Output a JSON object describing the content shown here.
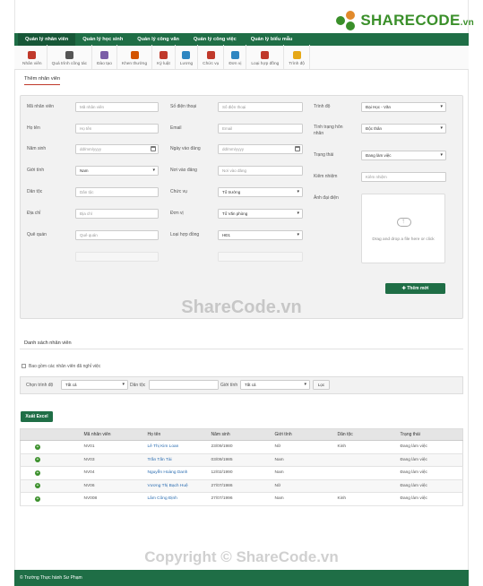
{
  "brand": {
    "logo_text": "SHARECODE",
    "logo_suffix": ".vn"
  },
  "topnav": {
    "items": [
      {
        "label": "Quản lý nhân viên",
        "active": true
      },
      {
        "label": "Quản lý học sinh"
      },
      {
        "label": "Quản lý công văn"
      },
      {
        "label": "Quản lý công việc"
      },
      {
        "label": "Quản lý biểu mẫu"
      }
    ]
  },
  "toolbar": {
    "items": [
      {
        "label": "Nhân viên",
        "icon": "user-icon",
        "color": "#c0392b"
      },
      {
        "label": "Quá trình công tác",
        "icon": "progress-icon",
        "color": "#555555"
      },
      {
        "label": "Đào tạo",
        "icon": "book-icon",
        "color": "#7b5ea7"
      },
      {
        "label": "Khen thưởng",
        "icon": "gift-icon",
        "color": "#d35400"
      },
      {
        "label": "Kỷ luật",
        "icon": "shield-icon",
        "color": "#c0392b"
      },
      {
        "label": "Lương",
        "icon": "money-icon",
        "color": "#2e86c1"
      },
      {
        "label": "Chức vụ",
        "icon": "chair-icon",
        "color": "#c0392b"
      },
      {
        "label": "Đơn vị",
        "icon": "unit-icon",
        "color": "#2e86c1"
      },
      {
        "label": "Loại hợp đồng",
        "icon": "contract-icon",
        "color": "#c0392b"
      },
      {
        "label": "Trình độ",
        "icon": "degree-icon",
        "color": "#e6a817"
      }
    ]
  },
  "add_section": {
    "tab_label": "Thêm nhân viên",
    "col1": [
      {
        "label": "Mã nhân viên",
        "value": "Mã nhân viên"
      },
      {
        "label": "Họ tên",
        "value": "Họ tên"
      },
      {
        "label": "Năm sinh",
        "value": "dd/mm/yyyy"
      },
      {
        "label": "Giới tính",
        "value": "Nam"
      },
      {
        "label": "Dân tộc",
        "value": "Dân tộc"
      },
      {
        "label": "Địa chỉ",
        "value": "Địa chỉ"
      },
      {
        "label": "Quê quán",
        "value": "Quê quán"
      }
    ],
    "col2": [
      {
        "label": "Số điện thoại",
        "value": "Số điện thoại"
      },
      {
        "label": "Email",
        "value": "Email"
      },
      {
        "label": "Ngày vào đảng",
        "value": "dd/mm/yyyy"
      },
      {
        "label": "Nơi vào đảng",
        "value": "Nơi vào đảng"
      },
      {
        "label": "Chức vụ",
        "value": "Tổ trưởng"
      },
      {
        "label": "Đơn vị",
        "value": "Tổ Văn phòng"
      },
      {
        "label": "Loại hợp đồng",
        "value": "HĐ1"
      }
    ],
    "col3": [
      {
        "label": "Trình độ",
        "value": "Đại Học - Văn"
      },
      {
        "label": "Tình trạng hôn nhân",
        "value": "Độc thân"
      },
      {
        "label": "Trạng thái",
        "value": "Đang làm việc"
      },
      {
        "label": "Kiêm nhiệm",
        "value": "Kiêm nhiệm"
      },
      {
        "label": "Ảnh đại diện",
        "value": ""
      }
    ],
    "dropzone_text": "Drag and drop a file here or click",
    "submit_label": "✚ Thêm mới"
  },
  "list_section": {
    "tab_label": "Danh sách nhân viên",
    "checkbox_label": "Bao gồm các nhân viên đã nghỉ việc",
    "filters": {
      "level_label": "Chọn trình độ",
      "level_value": "Tất cả",
      "ethnic_label": "Dân tộc",
      "ethnic_value": "",
      "gender_label": "Giới tính",
      "gender_value": "Tất cả",
      "filter_button": "Lọc"
    },
    "export_label": "Xuất Excel",
    "columns": [
      "",
      "Mã nhân viên",
      "Họ tên",
      "Năm sinh",
      "Giới tính",
      "Dân tộc",
      "Trạng thái"
    ],
    "rows": [
      {
        "code": "NV01",
        "name": "Lê Thị Kim Loan",
        "dob": "23/09/1980",
        "gender": "Nữ",
        "ethnic": "Kinh",
        "status": "Đang làm việc"
      },
      {
        "code": "NV03",
        "name": "Trần Tấn Tài",
        "dob": "03/09/1985",
        "gender": "Nam",
        "ethnic": "",
        "status": "Đang làm việc"
      },
      {
        "code": "NV04",
        "name": "Nguyễn Hoàng Danh",
        "dob": "12/02/1990",
        "gender": "Nam",
        "ethnic": "",
        "status": "Đang làm việc"
      },
      {
        "code": "NV06",
        "name": "Vương Thị Bạch Huệ",
        "dob": "27/07/1986",
        "gender": "Nữ",
        "ethnic": "",
        "status": "Đang làm việc"
      },
      {
        "code": "NV008",
        "name": "Lâm Công Định",
        "dob": "27/07/1996",
        "gender": "Nam",
        "ethnic": "Kinh",
        "status": "Đang làm việc"
      }
    ]
  },
  "footer": {
    "text": "© Trường Thực hành Sư Phạm"
  },
  "watermarks": [
    "ShareCode.vn",
    "Copyright © ShareCode.vn"
  ]
}
